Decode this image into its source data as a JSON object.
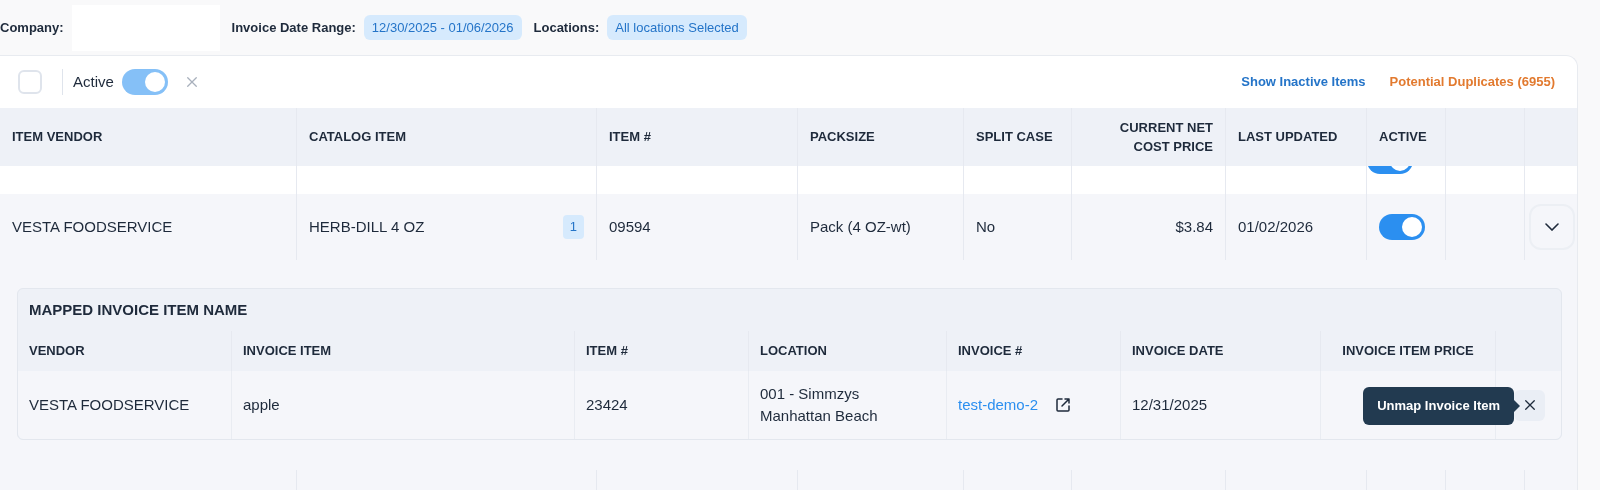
{
  "filters": [
    {
      "label": "Company:",
      "kind": "blank"
    },
    {
      "label": "Invoice Date Range:",
      "kind": "chip",
      "value": "12/30/2025 - 01/06/2026"
    },
    {
      "label": "Locations:",
      "kind": "chip",
      "value": "All locations Selected"
    }
  ],
  "toolbar": {
    "select_all": {
      "checked": false
    },
    "active_filter": {
      "label": "Active",
      "on": true
    },
    "show_inactive": "Show Inactive Items",
    "duplicates": "Potential Duplicates (6955)"
  },
  "table": {
    "columns": [
      "ITEM VENDOR",
      "CATALOG ITEM",
      "ITEM #",
      "PACKSIZE",
      "SPLIT CASE",
      "CURRENT NET COST PRICE",
      "LAST UPDATED",
      "ACTIVE"
    ],
    "rows": [
      {
        "kind": "partial",
        "active": true
      },
      {
        "kind": "full",
        "vendor": "VESTA FOODSERVICE",
        "catalog_item": "HERB-DILL 4 OZ",
        "count": "1",
        "item_no": "09594",
        "packsize": "Pack (4 OZ-wt)",
        "split_case": "No",
        "cost": "$3.84",
        "last_updated": "01/02/2026",
        "active": true,
        "expanded": true
      }
    ]
  },
  "mapped": {
    "title": "MAPPED INVOICE ITEM NAME",
    "columns": [
      "VENDOR",
      "INVOICE ITEM",
      "ITEM #",
      "LOCATION",
      "INVOICE #",
      "INVOICE DATE",
      "INVOICE ITEM PRICE"
    ],
    "rows": [
      {
        "vendor": "VESTA FOODSERVICE",
        "invoice_item": "apple",
        "item_no": "23424",
        "location": "001 - Simmzys Manhattan Beach",
        "invoice_no": "test-demo-2",
        "invoice_date": "12/31/2025"
      }
    ],
    "tooltip": "Unmap Invoice Item"
  }
}
